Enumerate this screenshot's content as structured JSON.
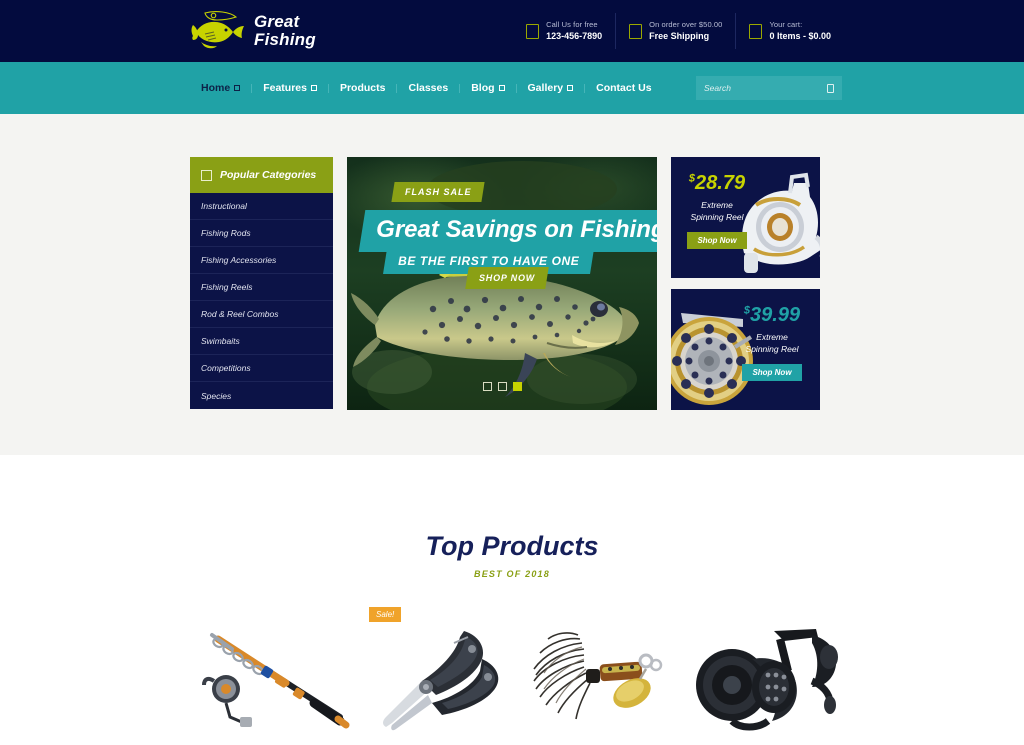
{
  "site": {
    "brand_line1": "Great",
    "brand_line2": "Fishing",
    "logo_icon": "fish-logo-icon"
  },
  "topbar": {
    "items": [
      {
        "icon": "phone-icon",
        "label": "Call Us for free",
        "value": "123-456-7890"
      },
      {
        "icon": "truck-icon",
        "label": "On order over $50.00",
        "value": "Free Shipping"
      },
      {
        "icon": "cart-icon",
        "label": "Your cart:",
        "value": "0 Items - $0.00"
      }
    ]
  },
  "nav": {
    "items": [
      {
        "label": "Home",
        "has_dropdown": true,
        "active": true
      },
      {
        "label": "Features",
        "has_dropdown": true,
        "active": false
      },
      {
        "label": "Products",
        "has_dropdown": false,
        "active": false
      },
      {
        "label": "Classes",
        "has_dropdown": false,
        "active": false
      },
      {
        "label": "Blog",
        "has_dropdown": true,
        "active": false
      },
      {
        "label": "Gallery",
        "has_dropdown": true,
        "active": false
      },
      {
        "label": "Contact Us",
        "has_dropdown": false,
        "active": false
      }
    ],
    "search": {
      "placeholder": "Search",
      "value": "",
      "icon": "search-icon"
    }
  },
  "sidebar": {
    "title": "Popular Categories",
    "icon": "list-icon",
    "items": [
      {
        "label": "Instructional"
      },
      {
        "label": "Fishing Rods"
      },
      {
        "label": "Fishing Accessories"
      },
      {
        "label": "Fishing Reels"
      },
      {
        "label": "Rod & Reel Combos"
      },
      {
        "label": "Swimbaits"
      },
      {
        "label": "Competitions"
      },
      {
        "label": "Species"
      }
    ]
  },
  "hero": {
    "flash_tag": "FLASH SALE",
    "title": "Great Savings on Fishing!",
    "subtitle": "BE THE FIRST TO HAVE ONE",
    "cta": "SHOP NOW",
    "image_alt": "brown-trout-underwater-photo",
    "slides": [
      {
        "active": false
      },
      {
        "active": false
      },
      {
        "active": true
      }
    ]
  },
  "promos": [
    {
      "currency": "$",
      "price": "28.79",
      "description_line1": "Extreme",
      "description_line2": "Spinning Reel",
      "button": "Shop Now",
      "price_color": "#c7d300",
      "button_color": "#8aa015",
      "image_alt": "white-spinning-reel-photo"
    },
    {
      "currency": "$",
      "price": "39.99",
      "description_line1": "Extreme",
      "description_line2": "Spinning Reel",
      "button": "Shop Now",
      "price_color": "#20a2a6",
      "button_color": "#20a2a6",
      "image_alt": "gold-fly-reel-photo"
    }
  ],
  "top_products": {
    "title": "Top Products",
    "subtitle": "BEST OF 2018",
    "items": [
      {
        "image_alt": "telescopic-fishing-rod-and-reel-combo",
        "badge": null
      },
      {
        "image_alt": "black-multi-tool-fishing-pliers",
        "badge": "Sale!"
      },
      {
        "image_alt": "gold-spinner-fishing-lure-with-feathers",
        "badge": null
      },
      {
        "image_alt": "black-spinning-reel",
        "badge": null
      }
    ]
  },
  "theme": {
    "navy": "#030b3e",
    "panel_navy": "#0c1347",
    "teal": "#20a2a6",
    "olive": "#8aa015",
    "lime": "#c7d300",
    "orange": "#f0a32a",
    "grey_band": "#f4f4f2"
  }
}
